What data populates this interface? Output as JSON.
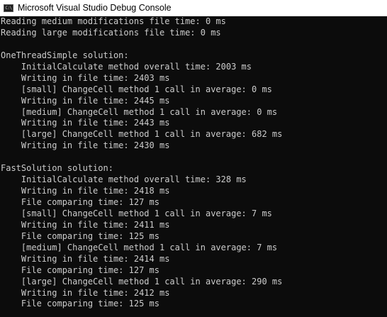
{
  "window": {
    "title": "Microsoft Visual Studio Debug Console",
    "icon": "console-app-icon",
    "icon_glyph": "C:\\"
  },
  "colors": {
    "background": "#0c0c0c",
    "text": "#cccccc",
    "titlebar": "#ffffff"
  },
  "console": {
    "lines": [
      "Reading medium modifications file time: 0 ms",
      "Reading large modifications file time: 0 ms",
      "",
      "OneThreadSimple solution:",
      "    InitialCalculate method overall time: 2003 ms",
      "    Writing in file time: 2403 ms",
      "    [small] ChangeCell method 1 call in average: 0 ms",
      "    Writing in file time: 2445 ms",
      "    [medium] ChangeCell method 1 call in average: 0 ms",
      "    Writing in file time: 2443 ms",
      "    [large] ChangeCell method 1 call in average: 682 ms",
      "    Writing in file time: 2430 ms",
      "",
      "FastSolution solution:",
      "    InitialCalculate method overall time: 328 ms",
      "    Writing in file time: 2418 ms",
      "    File comparing time: 127 ms",
      "    [small] ChangeCell method 1 call in average: 7 ms",
      "    Writing in file time: 2411 ms",
      "    File comparing time: 125 ms",
      "    [medium] ChangeCell method 1 call in average: 7 ms",
      "    Writing in file time: 2414 ms",
      "    File comparing time: 127 ms",
      "    [large] ChangeCell method 1 call in average: 290 ms",
      "    Writing in file time: 2412 ms",
      "    File comparing time: 125 ms"
    ]
  }
}
